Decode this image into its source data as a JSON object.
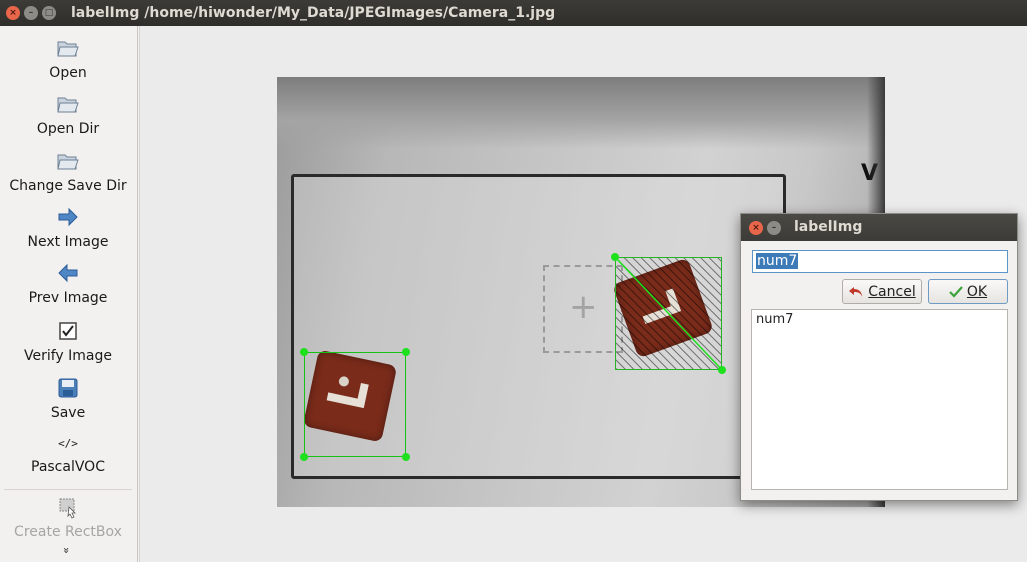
{
  "window": {
    "title": "labelImg /home/hiwonder/My_Data/JPEGImages/Camera_1.jpg",
    "buttons": {
      "close": "×",
      "minimize": "–",
      "maximize": "□"
    }
  },
  "toolbar": {
    "items": [
      {
        "label": "Open",
        "icon": "folder-icon",
        "enabled": true
      },
      {
        "label": "Open Dir",
        "icon": "folder-icon",
        "enabled": true
      },
      {
        "label": "Change Save Dir",
        "icon": "folder-icon",
        "enabled": true
      },
      {
        "label": "Next Image",
        "icon": "arrow-right-icon",
        "enabled": true
      },
      {
        "label": "Prev Image",
        "icon": "arrow-left-icon",
        "enabled": true
      },
      {
        "label": "Verify Image",
        "icon": "checkbox-icon",
        "enabled": true
      },
      {
        "label": "Save",
        "icon": "floppy-icon",
        "enabled": true
      },
      {
        "label": "PascalVOC",
        "icon": "code-tag-icon",
        "enabled": true
      },
      {
        "label": "Create RectBox",
        "icon": "rectbox-icon",
        "enabled": false
      }
    ],
    "format_glyph": "</>",
    "more": "»"
  },
  "canvas": {
    "photo_text": "V",
    "boxes": [
      "box-left",
      "box-right-selected"
    ],
    "colors": {
      "box": "#15c215",
      "handle": "#1ee11e",
      "card": "#7a2b1a"
    }
  },
  "dialog": {
    "title": "labelImg",
    "input_value": "num7",
    "cancel_label": "Cancel",
    "ok_label": "OK",
    "list": [
      "num7"
    ],
    "colors": {
      "selection": "#3d7ab8"
    }
  }
}
